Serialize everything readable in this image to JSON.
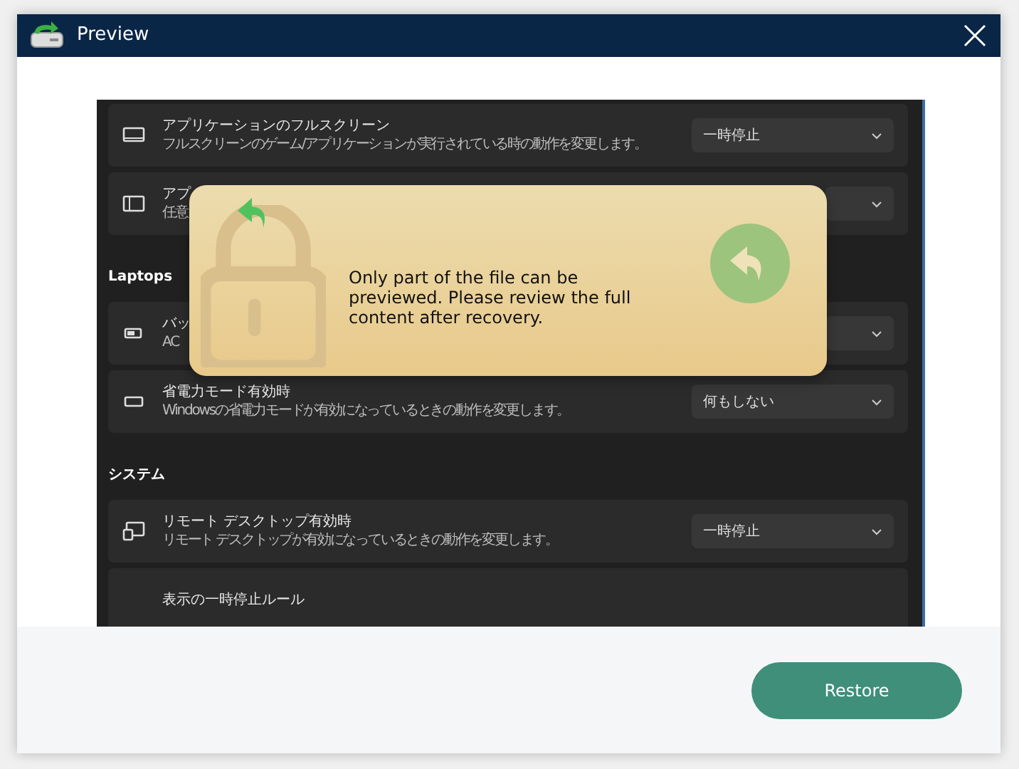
{
  "window": {
    "title": "Preview"
  },
  "preview": {
    "sections": [
      {
        "rows": [
          {
            "kind": "dropdown",
            "title": "アプリケーションのフルスクリーン",
            "subtitle": "フルスクリーンのゲーム/アプリケーションが実行されている時の動作を変更します。",
            "value": "一時停止"
          },
          {
            "kind": "dropdown",
            "title": "アプ",
            "subtitle": "任意"
          }
        ]
      },
      {
        "heading": "Laptops",
        "rows": [
          {
            "kind": "dropdown",
            "title": "バッ",
            "subtitle": "AC"
          },
          {
            "kind": "dropdown",
            "title": "省電力モード有効時",
            "subtitle": "Windowsの省電力モードが有効になっているときの動作を変更します。",
            "value": "何もしない"
          }
        ]
      },
      {
        "heading": "システム",
        "rows": [
          {
            "kind": "dropdown",
            "title": "リモート デスクトップ有効時",
            "subtitle": "リモート デスクトップが有効になっているときの動作を変更します。",
            "value": "一時停止"
          },
          {
            "kind": "plain",
            "title": "表示の一時停止ルール"
          }
        ]
      }
    ]
  },
  "notice": {
    "message": "Only part of the file can be previewed. Please review the full content after recovery."
  },
  "buttons": [
    {
      "label": "Restore"
    }
  ]
}
